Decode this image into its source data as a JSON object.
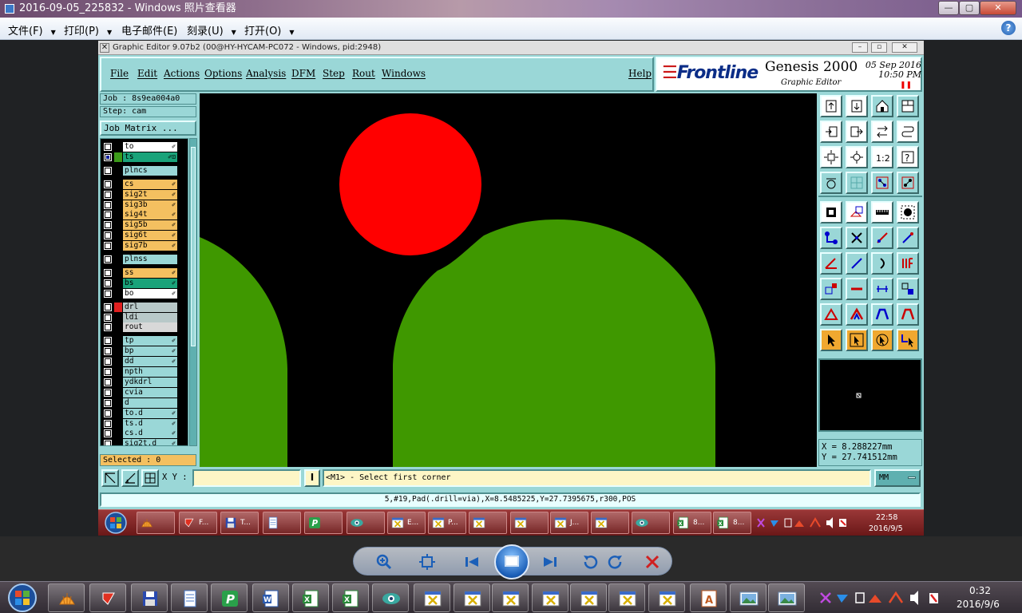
{
  "photo_viewer": {
    "title": "2016-09-05_225832 - Windows 照片查看器",
    "menu": [
      {
        "label": "文件(F)"
      },
      {
        "label": "打印(P)"
      },
      {
        "label": "电子邮件(E)"
      },
      {
        "label": "刻录(U)"
      },
      {
        "label": "打开(O)"
      }
    ],
    "help_glyph": "?"
  },
  "genesis": {
    "window_title": "Graphic Editor 9.07b2 (00@HY-HYCAM-PC072 - Windows, pid:2948)",
    "menu": [
      "File",
      "Edit",
      "Actions",
      "Options",
      "Analysis",
      "DFM",
      "Step",
      "Rout",
      "Windows"
    ],
    "help": "Help",
    "brand": {
      "logo": "Frontline",
      "product": "Genesis 2000",
      "subtitle": "Graphic Editor",
      "date": "05 Sep 2016",
      "time": "10:50 PM"
    },
    "job": "Job : 8s9ea004a0",
    "step": "Step: cam",
    "job_matrix": "Job Matrix ...",
    "layers": [
      {
        "name": "to",
        "color": "#ffffff",
        "checked": false,
        "swatch": "#000000",
        "mark": "✐"
      },
      {
        "name": "ts",
        "color": "#1aa37a",
        "checked": true,
        "swatch": "#3c9a1a",
        "mark": "✐⊡"
      },
      {
        "name": "plncs",
        "color": "#9ad7d7",
        "checked": false,
        "swatch": "#000000",
        "mark": ""
      },
      {
        "name": "cs",
        "color": "#f4c060",
        "checked": false,
        "swatch": "#000000",
        "mark": "✐"
      },
      {
        "name": "sig2t",
        "color": "#f4c060",
        "checked": false,
        "swatch": "#000000",
        "mark": "✐"
      },
      {
        "name": "sig3b",
        "color": "#f4c060",
        "checked": false,
        "swatch": "#000000",
        "mark": "✐"
      },
      {
        "name": "sig4t",
        "color": "#f4c060",
        "checked": false,
        "swatch": "#000000",
        "mark": "✐"
      },
      {
        "name": "sig5b",
        "color": "#f4c060",
        "checked": false,
        "swatch": "#000000",
        "mark": "✐"
      },
      {
        "name": "sig6t",
        "color": "#f4c060",
        "checked": false,
        "swatch": "#000000",
        "mark": "✐"
      },
      {
        "name": "sig7b",
        "color": "#f4c060",
        "checked": false,
        "swatch": "#000000",
        "mark": "✐"
      },
      {
        "name": "plnss",
        "color": "#9ad7d7",
        "checked": false,
        "swatch": "#000000",
        "mark": ""
      },
      {
        "name": "ss",
        "color": "#f4c060",
        "checked": false,
        "swatch": "#000000",
        "mark": "✐"
      },
      {
        "name": "bs",
        "color": "#1aa37a",
        "checked": false,
        "swatch": "#000000",
        "mark": "✐"
      },
      {
        "name": "bo",
        "color": "#ffffff",
        "checked": false,
        "swatch": "#000000",
        "mark": "✐"
      },
      {
        "name": "drl",
        "color": "#b8c8c8",
        "checked": false,
        "swatch": "#e02020",
        "mark": ""
      },
      {
        "name": "ldi",
        "color": "#b8c8c8",
        "checked": false,
        "swatch": "#000000",
        "mark": ""
      },
      {
        "name": "rout",
        "color": "#d8d8d8",
        "checked": false,
        "swatch": "#000000",
        "mark": ""
      },
      {
        "name": "tp",
        "color": "#9ad7d7",
        "checked": false,
        "swatch": "#000000",
        "mark": "✐"
      },
      {
        "name": "bp",
        "color": "#9ad7d7",
        "checked": false,
        "swatch": "#000000",
        "mark": "✐"
      },
      {
        "name": "dd",
        "color": "#9ad7d7",
        "checked": false,
        "swatch": "#000000",
        "mark": "✐"
      },
      {
        "name": "npth",
        "color": "#9ad7d7",
        "checked": false,
        "swatch": "#000000",
        "mark": ""
      },
      {
        "name": "ydkdrl",
        "color": "#9ad7d7",
        "checked": false,
        "swatch": "#000000",
        "mark": ""
      },
      {
        "name": "cvia",
        "color": "#9ad7d7",
        "checked": false,
        "swatch": "#000000",
        "mark": ""
      },
      {
        "name": "d",
        "color": "#9ad7d7",
        "checked": false,
        "swatch": "#000000",
        "mark": ""
      },
      {
        "name": "to.d",
        "color": "#9ad7d7",
        "checked": false,
        "swatch": "#000000",
        "mark": "✐"
      },
      {
        "name": "ts.d",
        "color": "#9ad7d7",
        "checked": false,
        "swatch": "#000000",
        "mark": "✐"
      },
      {
        "name": "cs.d",
        "color": "#9ad7d7",
        "checked": false,
        "swatch": "#000000",
        "mark": "✐"
      },
      {
        "name": "sig2t.d",
        "color": "#9ad7d7",
        "checked": false,
        "swatch": "#000000",
        "mark": "✐"
      }
    ],
    "selected": "Selected : 0",
    "coords": {
      "x": "X = 8.288227mm",
      "y": "Y = 27.741512mm"
    },
    "xy_label": "X Y :",
    "xy_value": "",
    "xy_toggle": "I",
    "prompt": "<M1> - Select first corner",
    "mode": "MM",
    "status": "5,#19,Pad(.drill=via),X=8.5485225,Y=27.7395675,r300,POS",
    "canvas_colors": {
      "background": "#000000",
      "pad": "#ff0000",
      "copper": "#3f9800"
    }
  },
  "inner_taskbar": {
    "items": [
      {
        "label": "",
        "kind": "shell"
      },
      {
        "label": "F...",
        "kind": "red"
      },
      {
        "label": "T...",
        "kind": "save"
      },
      {
        "label": "",
        "kind": "notes"
      },
      {
        "label": "",
        "kind": "green"
      },
      {
        "label": "",
        "kind": "eye"
      },
      {
        "label": "E...",
        "kind": "x"
      },
      {
        "label": "P...",
        "kind": "x"
      },
      {
        "label": "",
        "kind": "x"
      },
      {
        "label": "",
        "kind": "x"
      },
      {
        "label": "J...",
        "kind": "x"
      },
      {
        "label": "",
        "kind": "x"
      },
      {
        "label": "",
        "kind": "eye"
      },
      {
        "label": "8...",
        "kind": "xls"
      },
      {
        "label": "8...",
        "kind": "xls"
      }
    ],
    "time": "22:58",
    "date": "2016/9/5"
  },
  "taskbar": {
    "items": [
      "shell",
      "red",
      "save",
      "notes",
      "green",
      "word",
      "excel",
      "excel",
      "eye",
      "x",
      "x",
      "x",
      "x",
      "x",
      "x",
      "x",
      "ppt",
      "photo",
      "photo"
    ],
    "time": "0:32",
    "date": "2016/9/6"
  }
}
